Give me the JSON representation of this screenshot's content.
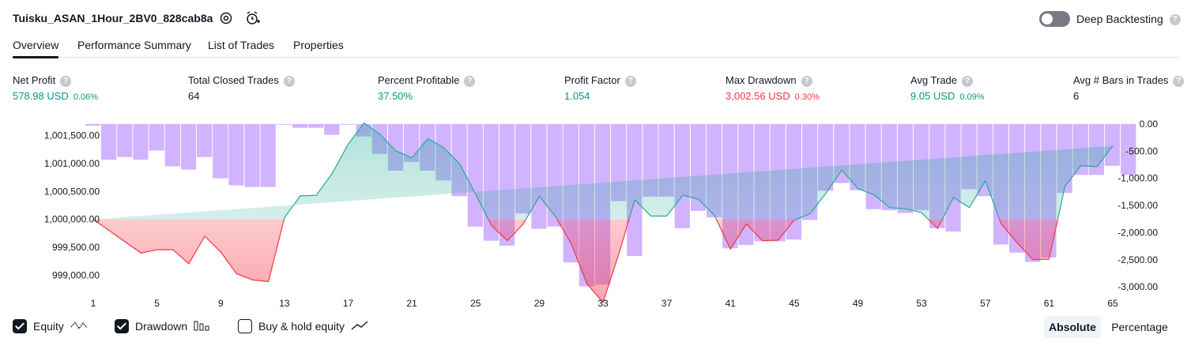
{
  "header": {
    "strategy_name": "Tuisku_ASAN_1Hour_2BV0_828cab8a",
    "settings_icon": "gear-icon",
    "alert_icon": "add-alarm-icon",
    "deep_backtesting_label": "Deep Backtesting",
    "deep_backtesting_enabled": false
  },
  "tabs": [
    {
      "label": "Overview",
      "active": true
    },
    {
      "label": "Performance Summary",
      "active": false
    },
    {
      "label": "List of Trades",
      "active": false
    },
    {
      "label": "Properties",
      "active": false
    }
  ],
  "metrics": [
    {
      "label": "Net Profit",
      "value": "578.98 USD",
      "pct": "0.06%",
      "tone": "green"
    },
    {
      "label": "Total Closed Trades",
      "value": "64",
      "pct": "",
      "tone": "dark"
    },
    {
      "label": "Percent Profitable",
      "value": "37.50%",
      "pct": "",
      "tone": "green"
    },
    {
      "label": "Profit Factor",
      "value": "1.054",
      "pct": "",
      "tone": "green"
    },
    {
      "label": "Max Drawdown",
      "value": "3,002.56 USD",
      "pct": "0.30%",
      "tone": "red"
    },
    {
      "label": "Avg Trade",
      "value": "9.05 USD",
      "pct": "0.09%",
      "tone": "green"
    },
    {
      "label": "Avg # Bars in Trades",
      "value": "6",
      "pct": "",
      "tone": "dark"
    }
  ],
  "colors": {
    "equity_up": "#22ab94",
    "equity_down": "#f23645",
    "drawdown_bar": "#d1b3ff",
    "text": "#131722"
  },
  "chart_data": {
    "type": "line",
    "x": [
      1,
      2,
      3,
      4,
      5,
      6,
      7,
      8,
      9,
      10,
      11,
      12,
      13,
      14,
      15,
      16,
      17,
      18,
      19,
      20,
      21,
      22,
      23,
      24,
      25,
      26,
      27,
      28,
      29,
      30,
      31,
      32,
      33,
      34,
      35,
      36,
      37,
      38,
      39,
      40,
      41,
      42,
      43,
      44,
      45,
      46,
      47,
      48,
      49,
      50,
      51,
      52,
      53,
      54,
      55,
      56,
      57,
      58,
      59,
      60,
      61,
      62,
      63,
      64,
      65
    ],
    "x_ticks": [
      "1",
      "5",
      "9",
      "13",
      "17",
      "21",
      "25",
      "29",
      "33",
      "37",
      "41",
      "45",
      "49",
      "53",
      "57",
      "61",
      "65"
    ],
    "y_left_ticks": [
      "1,001,500.00",
      "1,001,000.00",
      "1,000,500.00",
      "1,000,000.00",
      "999,500.00",
      "999,000.00"
    ],
    "y_right_ticks": [
      "0.00",
      "-500.00",
      "-1,000.00",
      "-1,500.00",
      "-2,000.00",
      "-2,500.00",
      "-3,000.00"
    ],
    "ylim_left": [
      998700,
      1001800
    ],
    "ylim_right": [
      -3100,
      100
    ],
    "baseline": 1000000,
    "series": [
      {
        "name": "Equity",
        "axis": "left",
        "values": [
          1000000,
          999800,
          999600,
          999400,
          999460,
          999460,
          999210,
          999700,
          999420,
          999030,
          998920,
          998890,
          1000030,
          1000420,
          1000430,
          1000820,
          1001340,
          1001720,
          1001520,
          1001220,
          1001100,
          1001440,
          1001280,
          1000990,
          1000450,
          999890,
          999620,
          999920,
          1000410,
          1000060,
          999570,
          998850,
          998520,
          999390,
          1000350,
          1000060,
          1000060,
          1000430,
          1000360,
          1000070,
          999470,
          999920,
          999620,
          999630,
          999990,
          1000100,
          1000470,
          1000880,
          1000550,
          1000440,
          1000210,
          1000190,
          1000120,
          999840,
          1000390,
          1000210,
          1000690,
          999920,
          999580,
          999280,
          999290,
          1000590,
          1000960,
          1000940,
          1001310,
          1000890,
          1000550
        ]
      },
      {
        "name": "Drawdown",
        "axis": "right",
        "values": [
          -30,
          -660,
          -610,
          -660,
          -490,
          -780,
          -840,
          -610,
          -1000,
          -1130,
          -1160,
          -1160,
          -10,
          -70,
          -70,
          -200,
          0,
          -230,
          -550,
          -860,
          -700,
          -860,
          -1040,
          -1330,
          -1890,
          -2150,
          -2240,
          -1650,
          -1930,
          -1890,
          -2550,
          -2990,
          -2960,
          -1420,
          -2430,
          -1340,
          -1340,
          -1920,
          -1600,
          -1720,
          -2290,
          -2230,
          -2160,
          -2160,
          -2130,
          -1770,
          -1230,
          -1090,
          -1220,
          -1570,
          -1590,
          -1640,
          -1590,
          -1920,
          -1980,
          -1200,
          -1330,
          -2220,
          -2370,
          -2540,
          -2460,
          -1270,
          -940,
          -940,
          -770,
          -940
        ]
      }
    ]
  },
  "legend": [
    {
      "label": "Equity",
      "checked": true,
      "icon": "equity-line-icon"
    },
    {
      "label": "Drawdown",
      "checked": true,
      "icon": "drawdown-bars-icon"
    },
    {
      "label": "Buy & hold equity",
      "checked": false,
      "icon": "buy-hold-line-icon"
    }
  ],
  "view_toggle": {
    "absolute_label": "Absolute",
    "percentage_label": "Percentage",
    "selected": "Absolute"
  }
}
